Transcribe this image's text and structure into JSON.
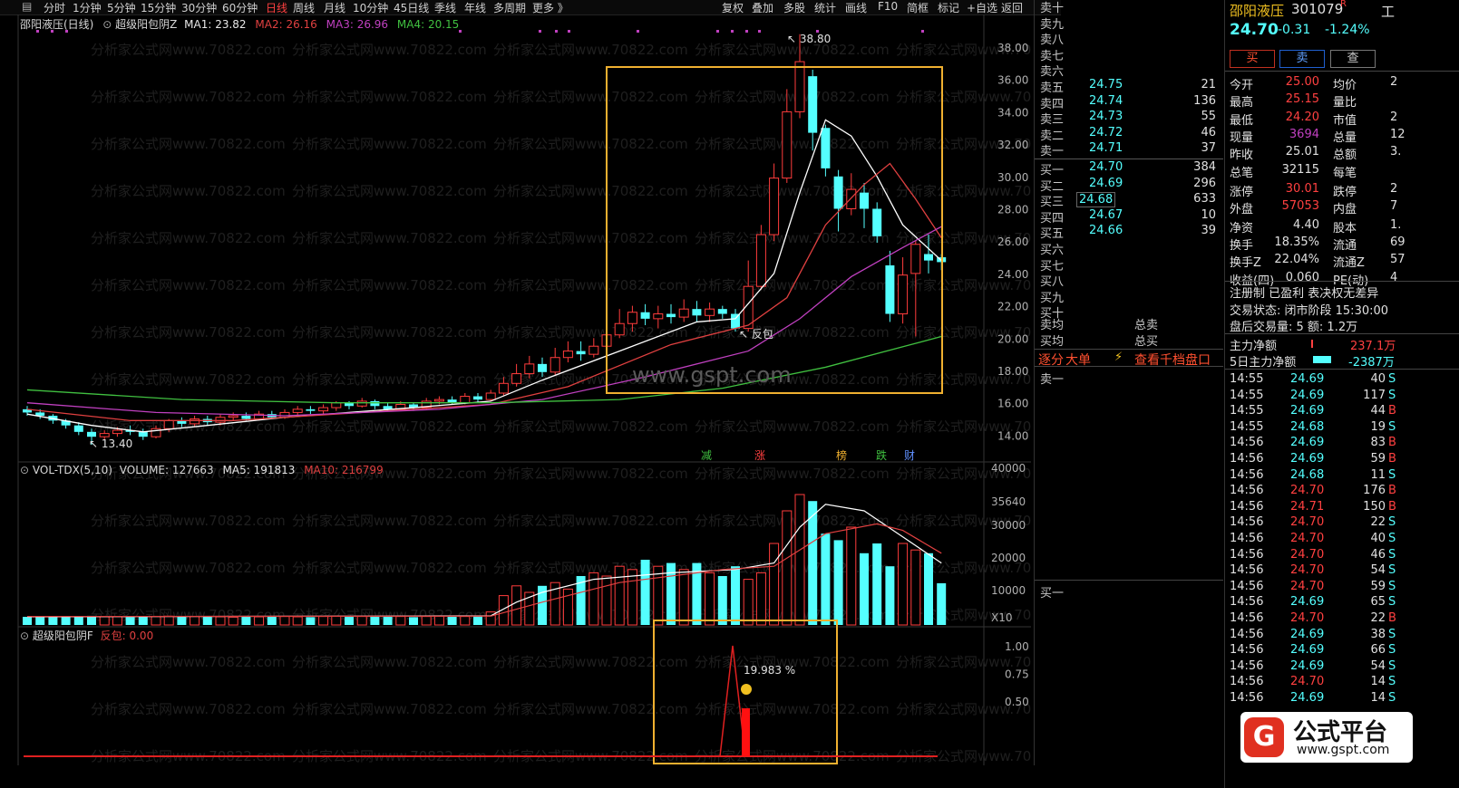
{
  "menu": {
    "items": [
      "分时",
      "1分钟",
      "5分钟",
      "15分钟",
      "30分钟",
      "60分钟",
      "日线",
      "周线",
      "月线",
      "10分钟",
      "45日线",
      "季线",
      "年线",
      "多周期",
      "更多 》"
    ],
    "active": "日线",
    "right": [
      "复权",
      "叠加",
      "多股",
      "统计",
      "画线",
      "F10",
      "简框",
      "标记",
      "+自选",
      "返回"
    ]
  },
  "kline_header": {
    "stock": "邵阳液压(日线)",
    "indicator": "超级阳包阴Z",
    "ma1": "MA1: 23.82",
    "ma2": "MA2: 26.16",
    "ma3": "MA3: 26.96",
    "ma4": "MA4: 20.15"
  },
  "kline_axis": [
    "38.00",
    "36.00",
    "34.00",
    "32.00",
    "30.00",
    "28.00",
    "26.00",
    "24.00",
    "22.00",
    "20.00",
    "18.00",
    "16.00",
    "14.00"
  ],
  "kline_annotations": {
    "high": "38.80",
    "low": "13.40",
    "signal": "反包",
    "watermark": "www.gspt.com",
    "tags": [
      "减",
      "涨",
      "榜",
      "跌",
      "财"
    ]
  },
  "watermark_text": "分析家公式网www.70822.com",
  "vol_header": {
    "name": "VOL-TDX(5,10)",
    "volume": "VOLUME: 127663",
    "ma5": "MA5: 191813",
    "ma10": "MA10: 216799"
  },
  "vol_axis": [
    "40000",
    "35640",
    "30000",
    "20000",
    "10000",
    "X10"
  ],
  "ind_header": {
    "name": "超级阳包阴F",
    "value": "反包: 0.00"
  },
  "ind_axis": [
    "1.00",
    "0.75",
    "0.50"
  ],
  "ind_annotation": "19.983 %",
  "colors": {
    "up": "#ff3c3c",
    "down": "#54ffff",
    "ma1": "#ffffff",
    "ma2": "#e04040",
    "ma3": "#c040c0",
    "ma4": "#40c040",
    "box": "#f0b030"
  },
  "orderbook": {
    "sell_empty": [
      "卖十",
      "卖九",
      "卖八",
      "卖七",
      "卖六"
    ],
    "sells": [
      {
        "label": "卖五",
        "price": "24.75",
        "vol": "21"
      },
      {
        "label": "卖四",
        "price": "24.74",
        "vol": "136"
      },
      {
        "label": "卖三",
        "price": "24.73",
        "vol": "55"
      },
      {
        "label": "卖二",
        "price": "24.72",
        "vol": "46"
      },
      {
        "label": "卖一",
        "price": "24.71",
        "vol": "37"
      }
    ],
    "buys": [
      {
        "label": "买一",
        "price": "24.70",
        "vol": "384"
      },
      {
        "label": "买二",
        "price": "24.69",
        "vol": "296"
      },
      {
        "label": "买三",
        "price": "24.68",
        "vol": "633"
      },
      {
        "label": "买四",
        "price": "24.67",
        "vol": "10"
      },
      {
        "label": "买五",
        "price": "24.66",
        "vol": "39"
      }
    ],
    "buy_empty": [
      "买六",
      "买七",
      "买八",
      "买九",
      "买十"
    ],
    "avg_sell": "卖均",
    "avg_buy": "买均",
    "total_sell": "总卖",
    "total_buy": "总买",
    "tab_fen": "逐分",
    "tab_big": "大单",
    "tab_thousand": "查看千档盘口",
    "detail_sell": "卖一",
    "detail_buy": "买一"
  },
  "quote": {
    "name": "邵阳液压",
    "code": "301079",
    "code_mark": "R",
    "corner": "工",
    "price": "24.70",
    "change": "-0.31",
    "pct": "-1.24%",
    "buttons": [
      "买",
      "卖",
      "查"
    ],
    "fields": [
      {
        "l": "今开",
        "v": "25.00",
        "l2": "均价",
        "v2": "2"
      },
      {
        "l": "最高",
        "v": "25.15",
        "l2": "量比",
        "v2": ""
      },
      {
        "l": "最低",
        "v": "24.20",
        "l2": "市值",
        "v2": "2"
      },
      {
        "l": "现量",
        "v": "3694",
        "l2": "总量",
        "v2": "12"
      },
      {
        "l": "昨收",
        "v": "25.01",
        "l2": "总额",
        "v2": "3."
      },
      {
        "l": "总笔",
        "v": "32115",
        "l2": "每笔",
        "v2": ""
      },
      {
        "l": "涨停",
        "v": "30.01",
        "l2": "跌停",
        "v2": "2"
      },
      {
        "l": "外盘",
        "v": "57053",
        "l2": "内盘",
        "v2": "7"
      },
      {
        "l": "净资",
        "v": "4.40",
        "l2": "股本",
        "v2": "1."
      },
      {
        "l": "换手",
        "v": "18.35%",
        "l2": "流通",
        "v2": "69"
      },
      {
        "l": "换手Z",
        "v": "22.04%",
        "l2": "流通Z",
        "v2": "57"
      },
      {
        "l": "收益(四)",
        "v": "0.060",
        "l2": "PE(动)",
        "v2": "4"
      }
    ],
    "reg_line": "注册制 已盈利 表决权无差异",
    "trade_state": "交易状态: 闭市阶段 15:30:00",
    "after_hours": "盘后交易量: 5  额: 1.2万",
    "main_net_label": "主力净额",
    "main_net": "237.1万",
    "main_net5_label": "5日主力净额",
    "main_net5": "-2387万"
  },
  "ticks": [
    {
      "t": "14:55",
      "p": "24.69",
      "v": "40",
      "s": "S"
    },
    {
      "t": "14:55",
      "p": "24.69",
      "v": "117",
      "s": "S"
    },
    {
      "t": "14:55",
      "p": "24.69",
      "v": "44",
      "s": "B"
    },
    {
      "t": "14:55",
      "p": "24.68",
      "v": "19",
      "s": "S"
    },
    {
      "t": "14:56",
      "p": "24.69",
      "v": "83",
      "s": "B"
    },
    {
      "t": "14:56",
      "p": "24.69",
      "v": "59",
      "s": "B"
    },
    {
      "t": "14:56",
      "p": "24.68",
      "v": "11",
      "s": "S"
    },
    {
      "t": "14:56",
      "p": "24.70",
      "v": "176",
      "s": "B"
    },
    {
      "t": "14:56",
      "p": "24.71",
      "v": "150",
      "s": "B"
    },
    {
      "t": "14:56",
      "p": "24.70",
      "v": "22",
      "s": "S"
    },
    {
      "t": "14:56",
      "p": "24.70",
      "v": "40",
      "s": "S"
    },
    {
      "t": "14:56",
      "p": "24.70",
      "v": "46",
      "s": "S"
    },
    {
      "t": "14:56",
      "p": "24.70",
      "v": "54",
      "s": "S"
    },
    {
      "t": "14:56",
      "p": "24.70",
      "v": "59",
      "s": "S"
    },
    {
      "t": "14:56",
      "p": "24.69",
      "v": "65",
      "s": "S"
    },
    {
      "t": "14:56",
      "p": "24.70",
      "v": "22",
      "s": "B"
    },
    {
      "t": "14:56",
      "p": "24.69",
      "v": "38",
      "s": "S"
    },
    {
      "t": "14:56",
      "p": "24.69",
      "v": "66",
      "s": "S"
    },
    {
      "t": "14:56",
      "p": "24.69",
      "v": "54",
      "s": "S"
    },
    {
      "t": "14:56",
      "p": "24.70",
      "v": "14",
      "s": "S"
    },
    {
      "t": "14:56",
      "p": "24.69",
      "v": "14",
      "s": "S"
    }
  ],
  "logo": {
    "brand": "公式平台",
    "url": "www.gspt.com"
  }
}
